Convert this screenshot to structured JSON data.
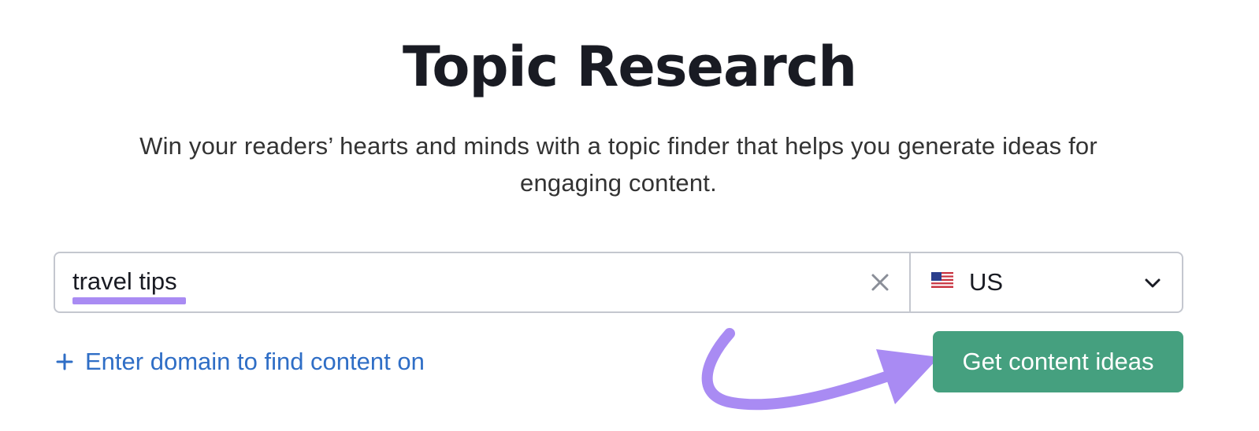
{
  "header": {
    "title": "Topic Research",
    "subtitle": "Win your readers’ hearts and minds with a topic finder that helps you generate ideas for engaging content."
  },
  "search": {
    "query_value": "travel tips",
    "clear_icon": "close-icon"
  },
  "country": {
    "flag_icon": "us-flag-icon",
    "label": "US",
    "dropdown_icon": "chevron-down-icon"
  },
  "domain_link": {
    "icon": "plus-icon",
    "label": "Enter domain to find content on"
  },
  "cta": {
    "label": "Get content ideas"
  },
  "colors": {
    "primary_button": "#45a07f",
    "link": "#2f6ec6",
    "highlight": "#a98bf3",
    "title_text": "#191b23"
  }
}
